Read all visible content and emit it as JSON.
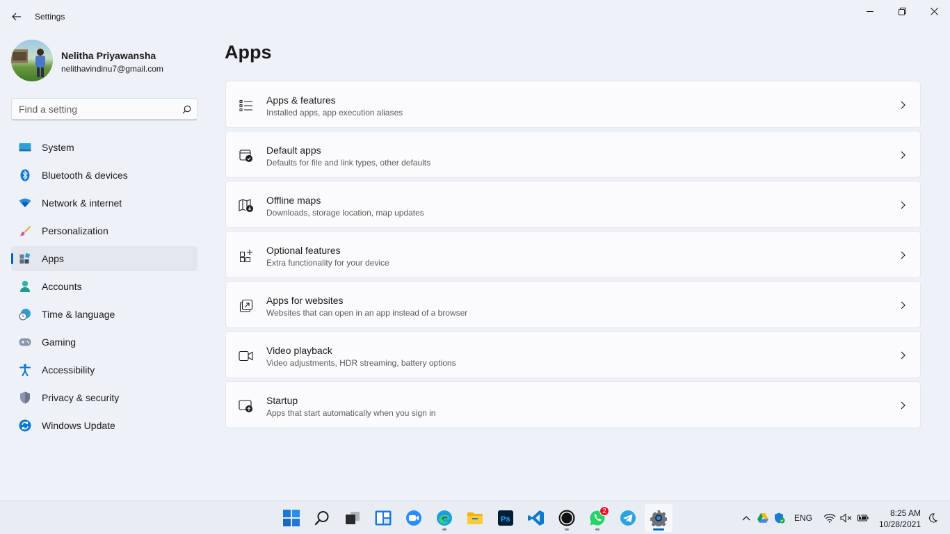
{
  "window": {
    "title": "Settings"
  },
  "profile": {
    "name": "Nelitha Priyawansha",
    "email": "nelithavindinu7@gmail.com"
  },
  "search": {
    "placeholder": "Find a setting"
  },
  "nav": {
    "items": [
      {
        "label": "System",
        "icon": "monitor-icon"
      },
      {
        "label": "Bluetooth & devices",
        "icon": "bluetooth-icon"
      },
      {
        "label": "Network & internet",
        "icon": "wifi-icon"
      },
      {
        "label": "Personalization",
        "icon": "brush-icon"
      },
      {
        "label": "Apps",
        "icon": "apps-icon",
        "active": true
      },
      {
        "label": "Accounts",
        "icon": "person-icon"
      },
      {
        "label": "Time & language",
        "icon": "globe-clock-icon"
      },
      {
        "label": "Gaming",
        "icon": "gamepad-icon"
      },
      {
        "label": "Accessibility",
        "icon": "accessibility-icon"
      },
      {
        "label": "Privacy & security",
        "icon": "shield-icon"
      },
      {
        "label": "Windows Update",
        "icon": "sync-icon"
      }
    ]
  },
  "main": {
    "title": "Apps",
    "cards": [
      {
        "title": "Apps & features",
        "subtitle": "Installed apps, app execution aliases",
        "icon": "list-icon"
      },
      {
        "title": "Default apps",
        "subtitle": "Defaults for file and link types, other defaults",
        "icon": "default-apps-icon"
      },
      {
        "title": "Offline maps",
        "subtitle": "Downloads, storage location, map updates",
        "icon": "map-download-icon"
      },
      {
        "title": "Optional features",
        "subtitle": "Extra functionality for your device",
        "icon": "grid-add-icon"
      },
      {
        "title": "Apps for websites",
        "subtitle": "Websites that can open in an app instead of a browser",
        "icon": "open-external-icon"
      },
      {
        "title": "Video playback",
        "subtitle": "Video adjustments, HDR streaming, battery options",
        "icon": "video-camera-icon"
      },
      {
        "title": "Startup",
        "subtitle": "Apps that start automatically when you sign in",
        "icon": "startup-icon"
      }
    ]
  },
  "taskbar": {
    "notification_count": "2",
    "language": "ENG",
    "time": "8:25 AM",
    "date": "10/28/2021"
  },
  "colors": {
    "accent": "#0067c0",
    "background": "#eef1f8",
    "card": "#fbfbfd"
  }
}
